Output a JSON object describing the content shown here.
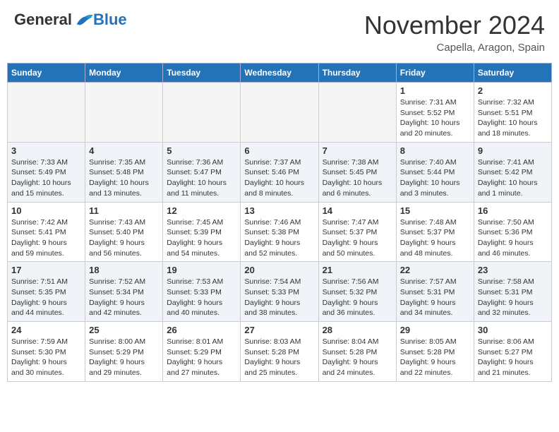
{
  "header": {
    "logo_general": "General",
    "logo_blue": "Blue",
    "month_title": "November 2024",
    "location": "Capella, Aragon, Spain"
  },
  "weekdays": [
    "Sunday",
    "Monday",
    "Tuesday",
    "Wednesday",
    "Thursday",
    "Friday",
    "Saturday"
  ],
  "weeks": [
    [
      {
        "day": "",
        "info": ""
      },
      {
        "day": "",
        "info": ""
      },
      {
        "day": "",
        "info": ""
      },
      {
        "day": "",
        "info": ""
      },
      {
        "day": "",
        "info": ""
      },
      {
        "day": "1",
        "info": "Sunrise: 7:31 AM\nSunset: 5:52 PM\nDaylight: 10 hours and 20 minutes."
      },
      {
        "day": "2",
        "info": "Sunrise: 7:32 AM\nSunset: 5:51 PM\nDaylight: 10 hours and 18 minutes."
      }
    ],
    [
      {
        "day": "3",
        "info": "Sunrise: 7:33 AM\nSunset: 5:49 PM\nDaylight: 10 hours and 15 minutes."
      },
      {
        "day": "4",
        "info": "Sunrise: 7:35 AM\nSunset: 5:48 PM\nDaylight: 10 hours and 13 minutes."
      },
      {
        "day": "5",
        "info": "Sunrise: 7:36 AM\nSunset: 5:47 PM\nDaylight: 10 hours and 11 minutes."
      },
      {
        "day": "6",
        "info": "Sunrise: 7:37 AM\nSunset: 5:46 PM\nDaylight: 10 hours and 8 minutes."
      },
      {
        "day": "7",
        "info": "Sunrise: 7:38 AM\nSunset: 5:45 PM\nDaylight: 10 hours and 6 minutes."
      },
      {
        "day": "8",
        "info": "Sunrise: 7:40 AM\nSunset: 5:44 PM\nDaylight: 10 hours and 3 minutes."
      },
      {
        "day": "9",
        "info": "Sunrise: 7:41 AM\nSunset: 5:42 PM\nDaylight: 10 hours and 1 minute."
      }
    ],
    [
      {
        "day": "10",
        "info": "Sunrise: 7:42 AM\nSunset: 5:41 PM\nDaylight: 9 hours and 59 minutes."
      },
      {
        "day": "11",
        "info": "Sunrise: 7:43 AM\nSunset: 5:40 PM\nDaylight: 9 hours and 56 minutes."
      },
      {
        "day": "12",
        "info": "Sunrise: 7:45 AM\nSunset: 5:39 PM\nDaylight: 9 hours and 54 minutes."
      },
      {
        "day": "13",
        "info": "Sunrise: 7:46 AM\nSunset: 5:38 PM\nDaylight: 9 hours and 52 minutes."
      },
      {
        "day": "14",
        "info": "Sunrise: 7:47 AM\nSunset: 5:37 PM\nDaylight: 9 hours and 50 minutes."
      },
      {
        "day": "15",
        "info": "Sunrise: 7:48 AM\nSunset: 5:37 PM\nDaylight: 9 hours and 48 minutes."
      },
      {
        "day": "16",
        "info": "Sunrise: 7:50 AM\nSunset: 5:36 PM\nDaylight: 9 hours and 46 minutes."
      }
    ],
    [
      {
        "day": "17",
        "info": "Sunrise: 7:51 AM\nSunset: 5:35 PM\nDaylight: 9 hours and 44 minutes."
      },
      {
        "day": "18",
        "info": "Sunrise: 7:52 AM\nSunset: 5:34 PM\nDaylight: 9 hours and 42 minutes."
      },
      {
        "day": "19",
        "info": "Sunrise: 7:53 AM\nSunset: 5:33 PM\nDaylight: 9 hours and 40 minutes."
      },
      {
        "day": "20",
        "info": "Sunrise: 7:54 AM\nSunset: 5:33 PM\nDaylight: 9 hours and 38 minutes."
      },
      {
        "day": "21",
        "info": "Sunrise: 7:56 AM\nSunset: 5:32 PM\nDaylight: 9 hours and 36 minutes."
      },
      {
        "day": "22",
        "info": "Sunrise: 7:57 AM\nSunset: 5:31 PM\nDaylight: 9 hours and 34 minutes."
      },
      {
        "day": "23",
        "info": "Sunrise: 7:58 AM\nSunset: 5:31 PM\nDaylight: 9 hours and 32 minutes."
      }
    ],
    [
      {
        "day": "24",
        "info": "Sunrise: 7:59 AM\nSunset: 5:30 PM\nDaylight: 9 hours and 30 minutes."
      },
      {
        "day": "25",
        "info": "Sunrise: 8:00 AM\nSunset: 5:29 PM\nDaylight: 9 hours and 29 minutes."
      },
      {
        "day": "26",
        "info": "Sunrise: 8:01 AM\nSunset: 5:29 PM\nDaylight: 9 hours and 27 minutes."
      },
      {
        "day": "27",
        "info": "Sunrise: 8:03 AM\nSunset: 5:28 PM\nDaylight: 9 hours and 25 minutes."
      },
      {
        "day": "28",
        "info": "Sunrise: 8:04 AM\nSunset: 5:28 PM\nDaylight: 9 hours and 24 minutes."
      },
      {
        "day": "29",
        "info": "Sunrise: 8:05 AM\nSunset: 5:28 PM\nDaylight: 9 hours and 22 minutes."
      },
      {
        "day": "30",
        "info": "Sunrise: 8:06 AM\nSunset: 5:27 PM\nDaylight: 9 hours and 21 minutes."
      }
    ]
  ]
}
